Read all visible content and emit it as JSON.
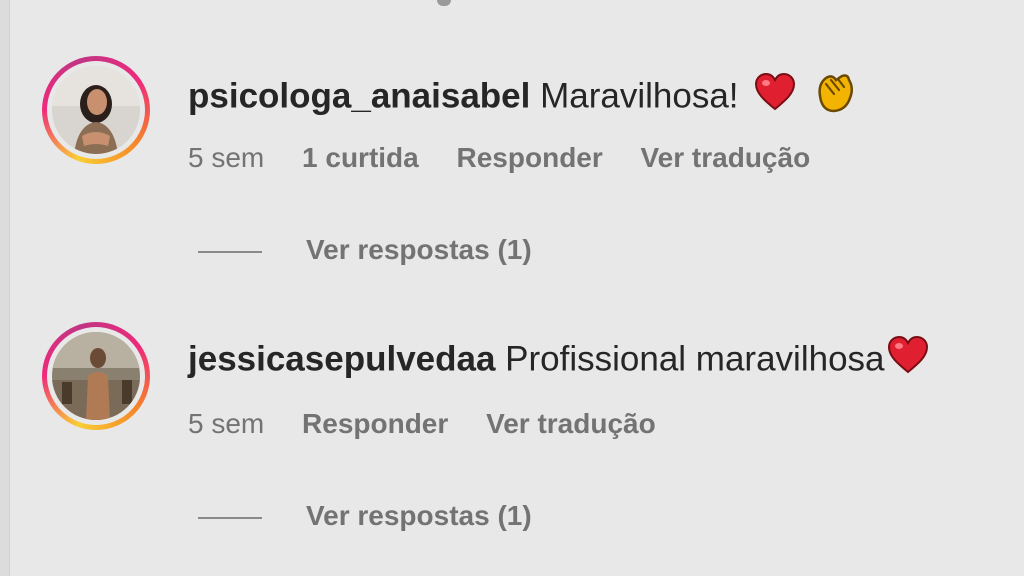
{
  "comments": [
    {
      "username": "psicologa_anaisabel",
      "text": "Maravilhosa!",
      "emojis": [
        "red-heart-emoji",
        "clapping-hands-emoji"
      ],
      "time": "5 sem",
      "likes": "1 curtida",
      "reply_label": "Responder",
      "translate_label": "Ver tradução",
      "view_replies": "Ver respostas (1)"
    },
    {
      "username": "jessicasepulvedaa",
      "text": "Profissional maravilhosa",
      "emojis": [
        "red-heart-emoji"
      ],
      "time": "5 sem",
      "reply_label": "Responder",
      "translate_label": "Ver tradução",
      "view_replies": "Ver respostas (1)"
    }
  ],
  "colors": {
    "background": "#e8e8e8",
    "primary_text": "#262626",
    "secondary_text": "#737373",
    "story_ring": [
      "#f9ce34",
      "#ee2a7b",
      "#c13584"
    ],
    "heart": "#e02030",
    "clap": "#f2b400"
  }
}
